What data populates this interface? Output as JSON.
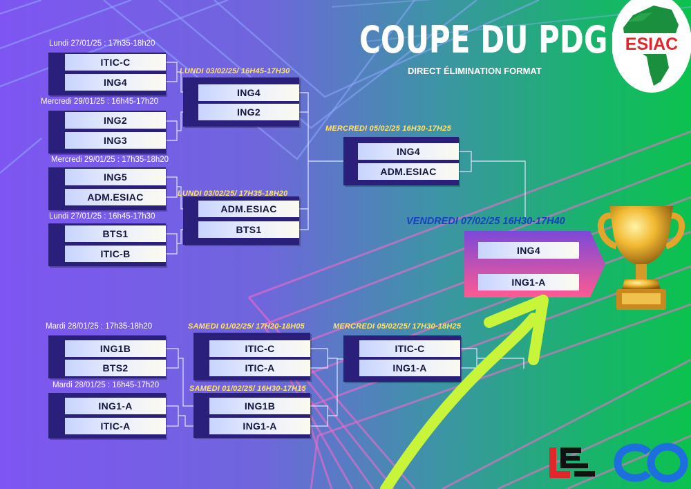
{
  "title": "COUPE DU PDG",
  "subtitle": "DIRECT ÉLIMINATION FORMAT",
  "logo_text": "ESIAC",
  "colors": {
    "accent_green": "#0fc14f",
    "logo_red": "#e3262b",
    "date_yellow": "#ffe36a",
    "final_blue": "#1a3fc2",
    "arrow_lime": "#c8f53a"
  },
  "top_bracket": {
    "r1_dates": [
      "Lundi  27/01/25 : 17h35-18h20",
      "Mercredi 29/01/25 : 16h45-17h20",
      "Mercredi 29/01/25 : 17h35-18h20",
      "Lundi  27/01/25 : 16h45-17h30"
    ],
    "r1_teams": [
      "ITIC-C",
      "ING4",
      "ING2",
      "ING3",
      "ING5",
      "ADM.ESIAC",
      "BTS1",
      "ITIC-B"
    ],
    "r2_dates": [
      "LUNDI 03/02/25/ 16H45-17H30",
      "LUNDI 03/02/25/ 17H35-18H20"
    ],
    "r2_teams": [
      "ING4",
      "ING2",
      "ADM.ESIAC",
      "BTS1"
    ],
    "semi_date": "MERCREDI 05/02/25 16H30-17H25",
    "semi_teams": [
      "ING4",
      "ADM.ESIAC"
    ]
  },
  "bottom_bracket": {
    "r1_dates": [
      "Mardi  28/01/25 : 17h35-18h20",
      "Mardi  28/01/25 : 16h45-17h20"
    ],
    "r1_teams": [
      "ING1B",
      "BTS2",
      "ING1-A",
      "ITIC-A"
    ],
    "r2_dates": [
      "SAMEDI 01/02/25/ 17H20-18H05",
      "SAMEDI 01/02/25/ 16H30-17H15"
    ],
    "r2_teams": [
      "ITIC-C",
      "ITIC-A",
      "ING1B",
      "ING1-A"
    ],
    "semi_date": "MERCREDI 05/02/25/ 17H30-18H25",
    "semi_teams": [
      "ITIC-C",
      "ING1-A"
    ]
  },
  "final": {
    "date": "VENDREDI 07/02/25 16H30-17H40",
    "teams": [
      "ING4",
      "ING1-A"
    ]
  },
  "icons": [
    "trophy-icon",
    "africa-map-icon",
    "sponsor-le-logo-icon",
    "sponsor-co-logo-icon",
    "arrow-icon"
  ]
}
